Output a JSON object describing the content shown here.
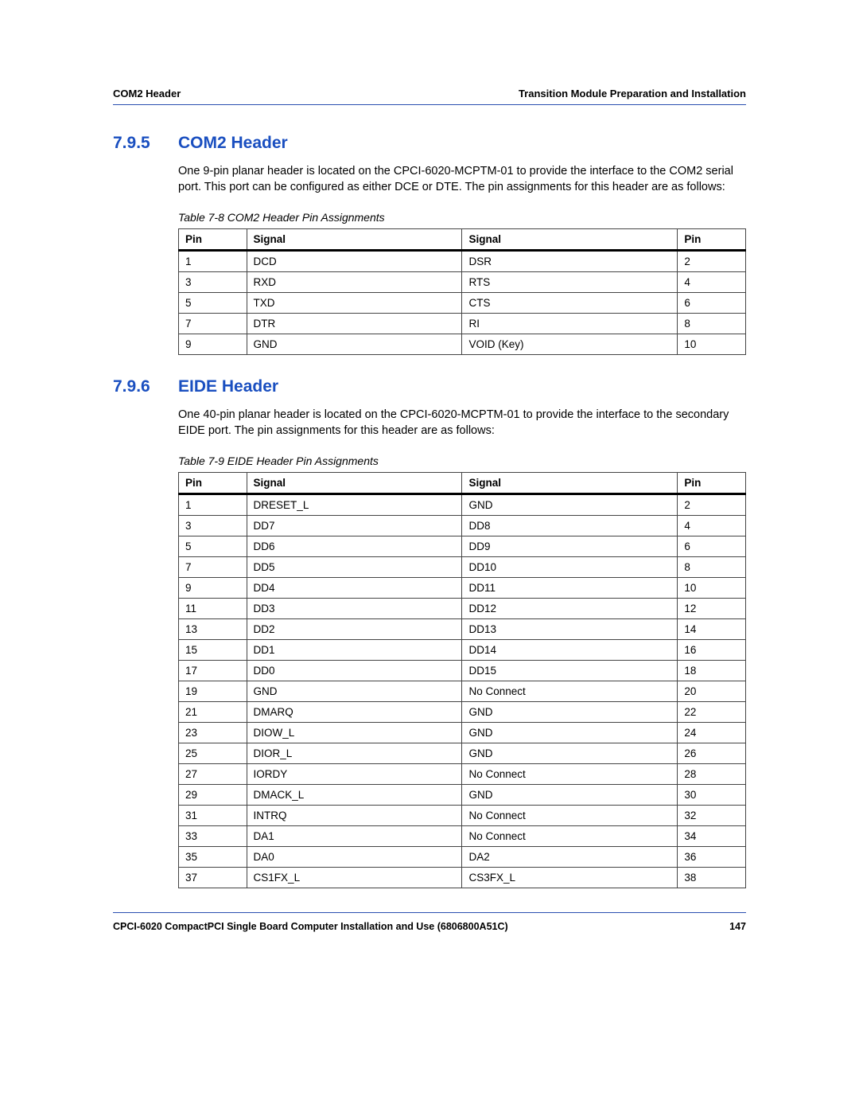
{
  "header": {
    "left": "COM2 Header",
    "right": "Transition Module Preparation and Installation"
  },
  "sections": [
    {
      "num": "7.9.5",
      "title": "COM2 Header",
      "body": "One 9-pin planar header is located on the CPCI-6020-MCPTM-01 to provide the interface to the COM2 serial port. This port can be configured as either DCE or DTE. The pin assignments for this header are as follows:",
      "caption": "Table 7-8 COM2 Header Pin Assignments",
      "columns": [
        "Pin",
        "Signal",
        "Signal",
        "Pin"
      ],
      "rows": [
        [
          "1",
          "DCD",
          "DSR",
          "2"
        ],
        [
          "3",
          "RXD",
          "RTS",
          "4"
        ],
        [
          "5",
          "TXD",
          "CTS",
          "6"
        ],
        [
          "7",
          "DTR",
          "RI",
          "8"
        ],
        [
          "9",
          "GND",
          "VOID (Key)",
          "10"
        ]
      ]
    },
    {
      "num": "7.9.6",
      "title": "EIDE Header",
      "body": "One 40-pin planar header is located on the CPCI-6020-MCPTM-01 to provide the interface to the secondary EIDE port. The pin assignments for this header are as follows:",
      "caption": "Table 7-9 EIDE Header Pin Assignments",
      "columns": [
        "Pin",
        "Signal",
        "Signal",
        "Pin"
      ],
      "rows": [
        [
          "1",
          "DRESET_L",
          "GND",
          "2"
        ],
        [
          "3",
          "DD7",
          "DD8",
          "4"
        ],
        [
          "5",
          "DD6",
          "DD9",
          "6"
        ],
        [
          "7",
          "DD5",
          "DD10",
          "8"
        ],
        [
          "9",
          "DD4",
          "DD11",
          "10"
        ],
        [
          "11",
          "DD3",
          "DD12",
          "12"
        ],
        [
          "13",
          "DD2",
          "DD13",
          "14"
        ],
        [
          "15",
          "DD1",
          "DD14",
          "16"
        ],
        [
          "17",
          "DD0",
          "DD15",
          "18"
        ],
        [
          "19",
          "GND",
          "No Connect",
          "20"
        ],
        [
          "21",
          "DMARQ",
          "GND",
          "22"
        ],
        [
          "23",
          "DIOW_L",
          "GND",
          "24"
        ],
        [
          "25",
          "DIOR_L",
          "GND",
          "26"
        ],
        [
          "27",
          "IORDY",
          "No Connect",
          "28"
        ],
        [
          "29",
          "DMACK_L",
          "GND",
          "30"
        ],
        [
          "31",
          "INTRQ",
          "No Connect",
          "32"
        ],
        [
          "33",
          "DA1",
          "No Connect",
          "34"
        ],
        [
          "35",
          "DA0",
          "DA2",
          "36"
        ],
        [
          "37",
          "CS1FX_L",
          "CS3FX_L",
          "38"
        ]
      ]
    }
  ],
  "footer": {
    "left": "CPCI-6020 CompactPCI Single Board Computer Installation and Use (6806800A51C)",
    "right": "147"
  }
}
